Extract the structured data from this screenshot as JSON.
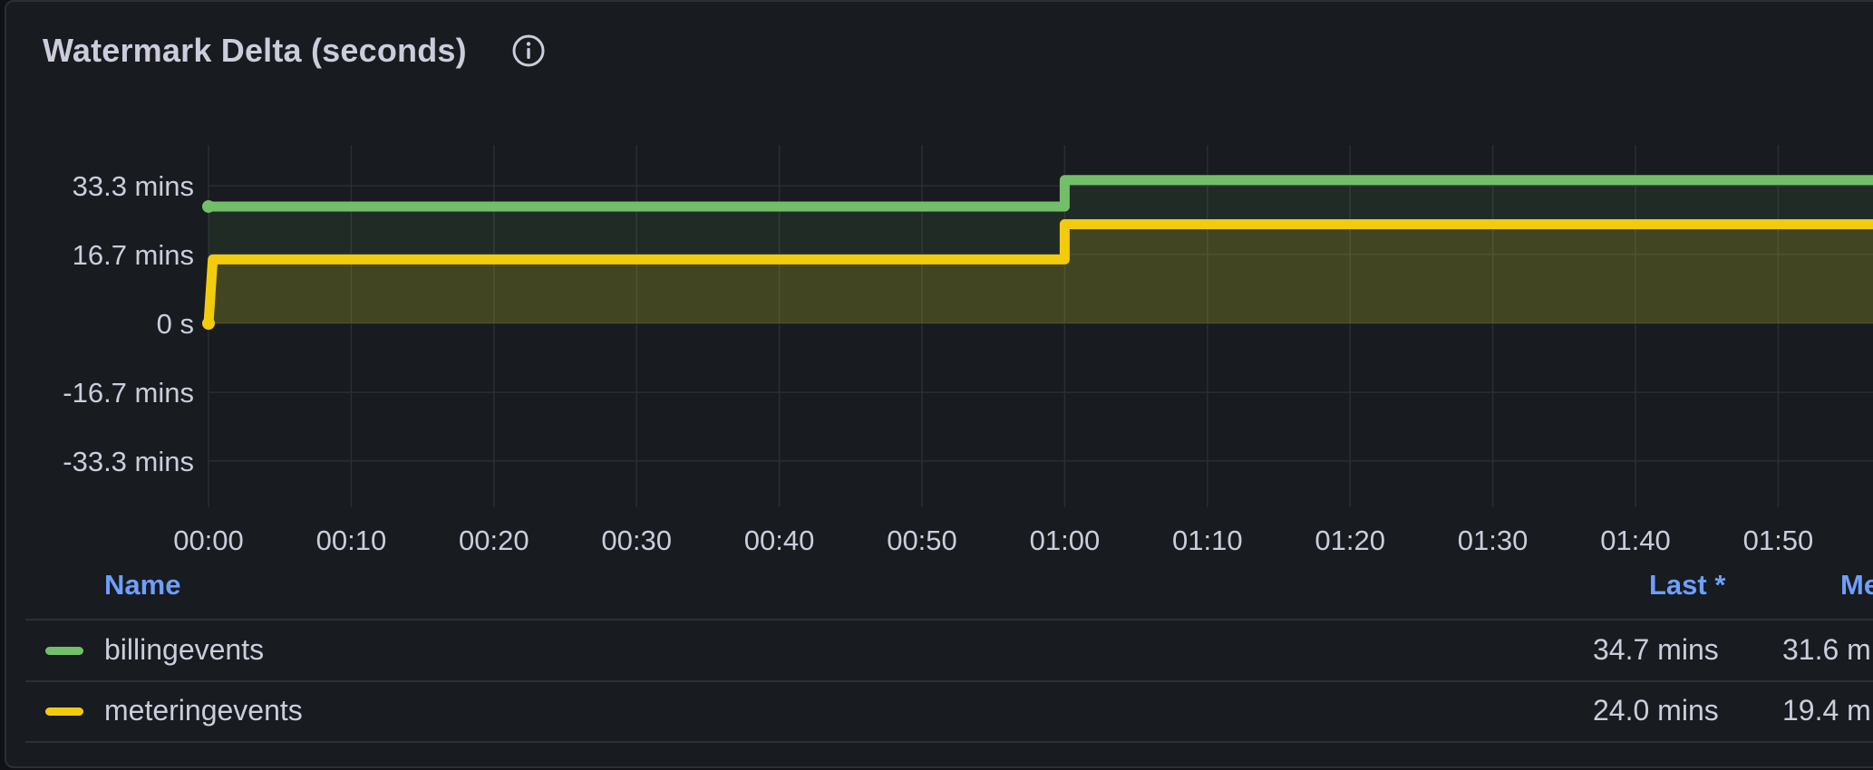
{
  "panel": {
    "title": "Watermark Delta (seconds)",
    "info_icon": "info-circle-icon"
  },
  "chart_data": {
    "type": "line",
    "style": "step",
    "x_ticks": [
      "00:00",
      "00:10",
      "00:20",
      "00:30",
      "00:40",
      "00:50",
      "01:00",
      "01:10",
      "01:20",
      "01:30",
      "01:40",
      "01:50"
    ],
    "y_ticks": [
      "33.3 mins",
      "16.7 mins",
      "0 s",
      "-16.7 mins",
      "-33.3 mins"
    ],
    "ylim_mins": [
      -41.7,
      43.3
    ],
    "xlim_minutes": [
      -1.6,
      117
    ],
    "grid": true,
    "fill_area": true,
    "series": [
      {
        "name": "billingevents",
        "color": "#73bf69",
        "points": [
          [
            0,
            28.3
          ],
          [
            60,
            28.3
          ],
          [
            60,
            34.7
          ],
          [
            117,
            34.7
          ]
        ]
      },
      {
        "name": "meteringevents",
        "color": "#f2cc0c",
        "points": [
          [
            0,
            0
          ],
          [
            0.3,
            15.5
          ],
          [
            60,
            15.5
          ],
          [
            60,
            24.0
          ],
          [
            117,
            24.0
          ]
        ]
      }
    ]
  },
  "legend": {
    "headers": {
      "name": "Name",
      "last": "Last *",
      "mean": "Me"
    },
    "rows": [
      {
        "name": "billingevents",
        "color": "#73bf69",
        "last": "34.7 mins",
        "mean": "31.6 m"
      },
      {
        "name": "meteringevents",
        "color": "#f2cc0c",
        "last": "24.0 mins",
        "mean": "19.4 m"
      }
    ]
  }
}
